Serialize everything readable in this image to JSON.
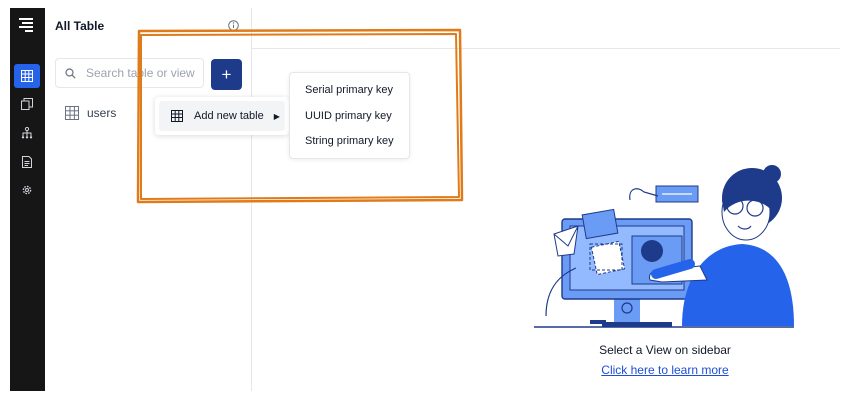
{
  "sidebar": {
    "logo_icon": "logo-icon",
    "items": [
      {
        "name": "tables",
        "icon": "table-icon",
        "active": true
      },
      {
        "name": "views",
        "icon": "copy-icon",
        "active": false
      },
      {
        "name": "schema",
        "icon": "hierarchy-icon",
        "active": false
      },
      {
        "name": "docs",
        "icon": "document-icon",
        "active": false
      },
      {
        "name": "settings",
        "icon": "gear-icon",
        "active": false
      }
    ]
  },
  "panel": {
    "title": "All Table",
    "search_placeholder": "Search table or view",
    "add_label": "+",
    "tables": [
      {
        "label": "users"
      }
    ]
  },
  "context_menu": {
    "add_new_table": "Add new table"
  },
  "submenu": {
    "items": [
      "Serial primary key",
      "UUID primary key",
      "String primary key"
    ]
  },
  "empty_state": {
    "caption": "Select a View on sidebar",
    "link": "Click here to learn more"
  },
  "colors": {
    "accent": "#2563eb",
    "add_button": "#1e3a8a",
    "annotation": "#e07b1a"
  }
}
